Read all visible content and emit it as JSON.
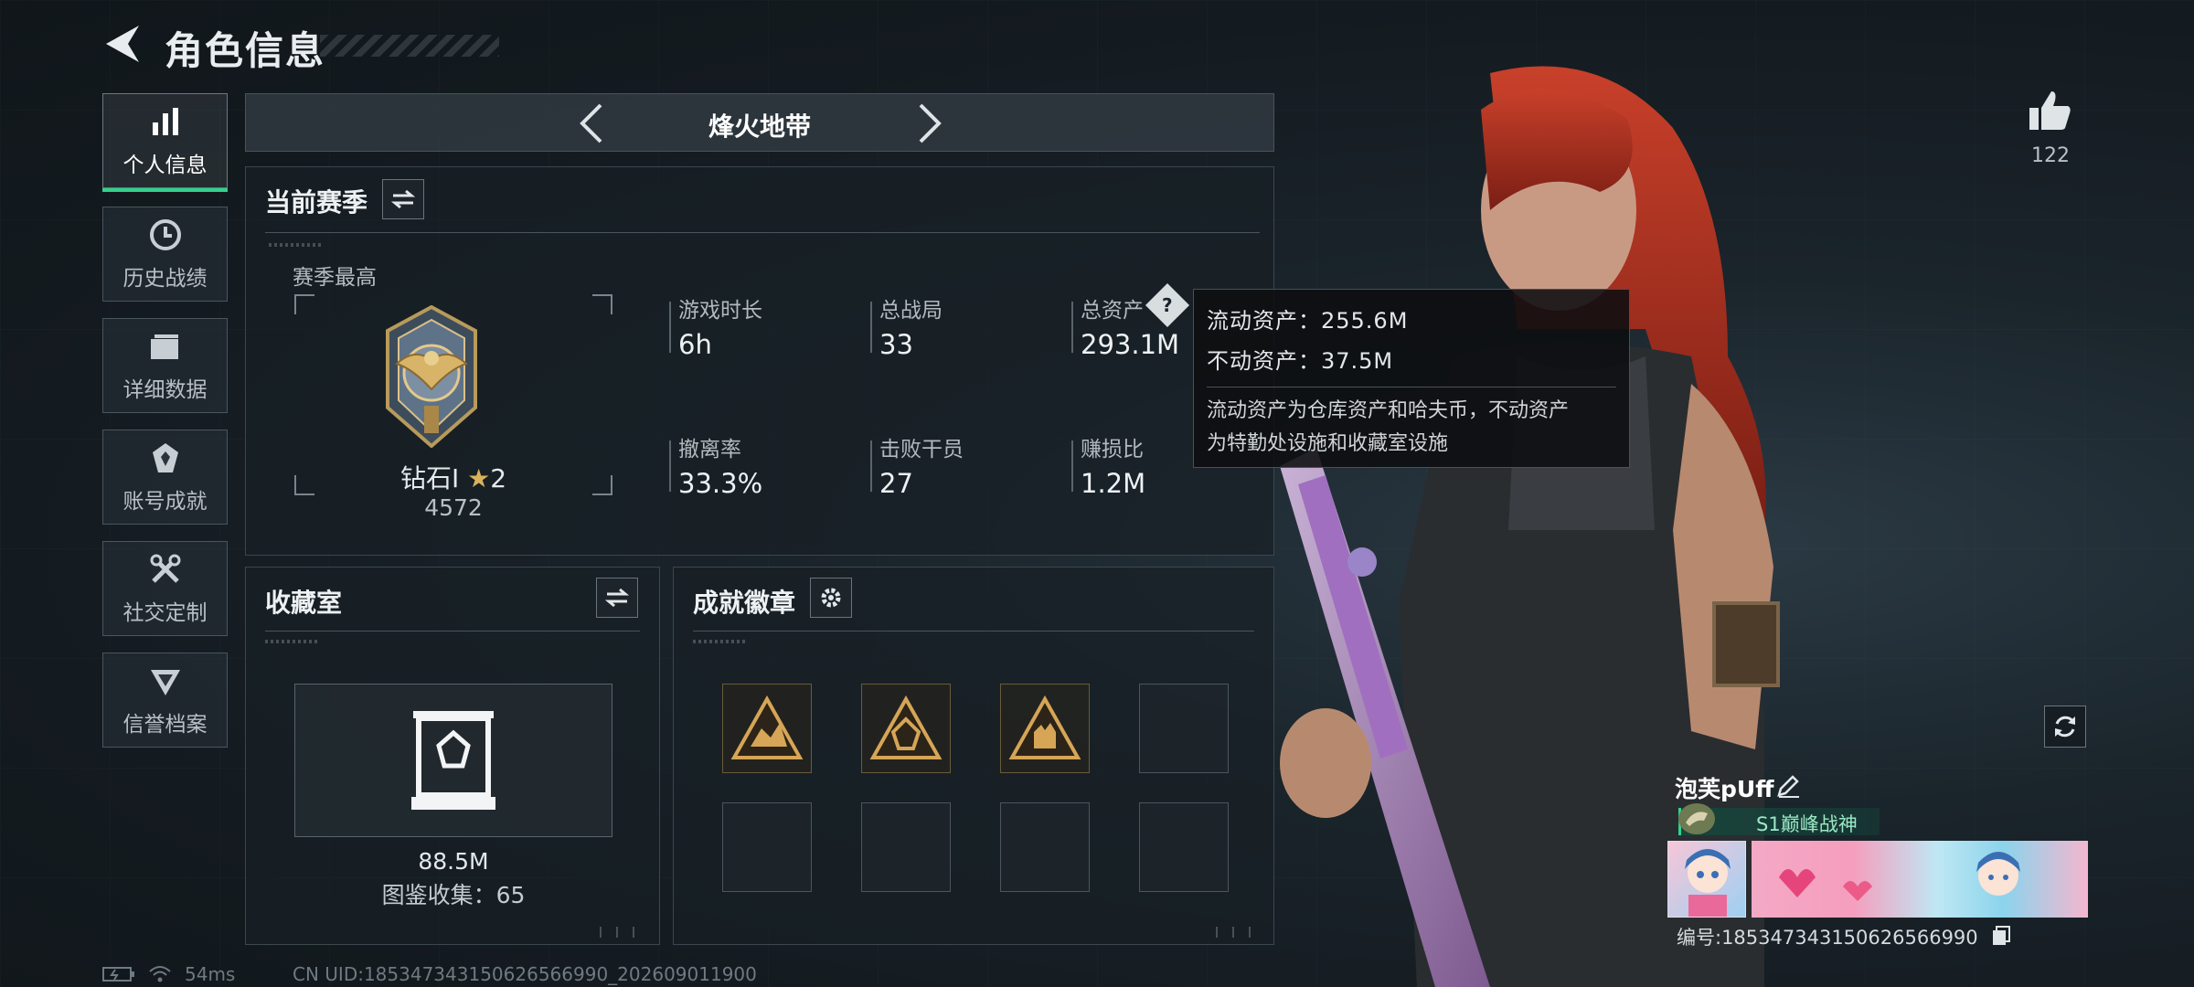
{
  "header": {
    "title": "角色信息"
  },
  "sidebar": {
    "items": [
      {
        "label": "个人信息",
        "active": true,
        "icon": "bar-chart-icon"
      },
      {
        "label": "历史战绩",
        "active": false,
        "icon": "history-icon"
      },
      {
        "label": "详细数据",
        "active": false,
        "icon": "folder-icon"
      },
      {
        "label": "账号成就",
        "active": false,
        "icon": "achievement-icon"
      },
      {
        "label": "社交定制",
        "active": false,
        "icon": "tools-icon"
      },
      {
        "label": "信誉档案",
        "active": false,
        "icon": "credit-icon"
      }
    ]
  },
  "mode": {
    "title": "烽火地带"
  },
  "season": {
    "title": "当前赛季",
    "best_label": "赛季最高",
    "rank_name": "钻石Ⅰ",
    "rank_stars": "2",
    "rank_score": "4572",
    "stats": [
      {
        "label": "游戏时长",
        "value": "6h"
      },
      {
        "label": "总战局",
        "value": "33"
      },
      {
        "label": "总资产",
        "value": "293.1M"
      },
      {
        "label": "撤离率",
        "value": "33.3%"
      },
      {
        "label": "击败干员",
        "value": "27"
      },
      {
        "label": "赚损比",
        "value": "1.2M"
      }
    ]
  },
  "tooltip": {
    "line1": "流动资产：255.6M",
    "line2": "不动资产：37.5M",
    "desc1": "流动资产为仓库资产和哈夫币，不动资产",
    "desc2": "为特勤处设施和收藏室设施"
  },
  "collection": {
    "title": "收藏室",
    "value": "88.5M",
    "count_text": "图鉴收集：65"
  },
  "badges": {
    "title": "成就徽章",
    "slots": [
      {
        "filled": true
      },
      {
        "filled": true
      },
      {
        "filled": true
      },
      {
        "filled": false
      },
      {
        "filled": false
      },
      {
        "filled": false
      },
      {
        "filled": false
      },
      {
        "filled": false
      }
    ]
  },
  "profile": {
    "likes": "122",
    "player_name": "泡芙pUff",
    "title_badge": "S1巅峰战神",
    "player_id": "编号:185347343150626566990"
  },
  "status": {
    "ping": "54ms",
    "uid": "CN UID:185347343150626566990_202609011900"
  },
  "colors": {
    "accent_green": "#2fd38c",
    "gold": "#d9b35a",
    "hair_red": "#b8321f"
  }
}
